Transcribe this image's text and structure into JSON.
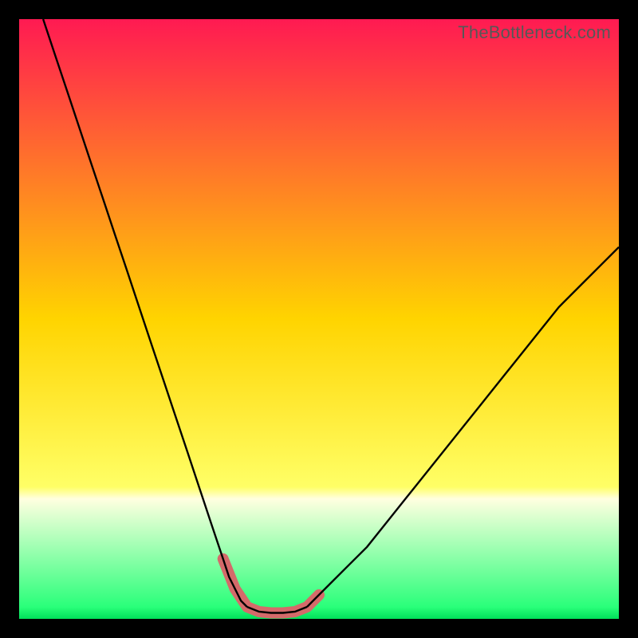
{
  "watermark": "TheBottleneck.com",
  "chart_data": {
    "type": "line",
    "title": "",
    "xlabel": "",
    "ylabel": "",
    "xlim": [
      0,
      100
    ],
    "ylim": [
      0,
      100
    ],
    "grid": false,
    "legend": false,
    "gradient_stops": [
      {
        "offset": 0.0,
        "color": "#ff1a52"
      },
      {
        "offset": 0.5,
        "color": "#ffd400"
      },
      {
        "offset": 0.78,
        "color": "#ffff66"
      },
      {
        "offset": 0.8,
        "color": "#ffffe0"
      },
      {
        "offset": 0.98,
        "color": "#2aff7a"
      },
      {
        "offset": 1.0,
        "color": "#00e05a"
      }
    ],
    "series": [
      {
        "name": "left-curve",
        "stroke": "#000000",
        "x": [
          4,
          6,
          8,
          10,
          12,
          14,
          16,
          18,
          20,
          22,
          24,
          26,
          28,
          30,
          32,
          34,
          35,
          36,
          37,
          38
        ],
        "y": [
          100,
          94,
          88,
          82,
          76,
          70,
          64,
          58,
          52,
          46,
          40,
          34,
          28,
          22,
          16,
          10,
          7,
          5,
          3,
          2
        ]
      },
      {
        "name": "right-curve",
        "stroke": "#000000",
        "x": [
          48,
          49,
          50,
          52,
          55,
          58,
          62,
          66,
          70,
          74,
          78,
          82,
          86,
          90,
          94,
          98,
          100
        ],
        "y": [
          2,
          3,
          4,
          6,
          9,
          12,
          17,
          22,
          27,
          32,
          37,
          42,
          47,
          52,
          56,
          60,
          62
        ]
      },
      {
        "name": "bottom-flat",
        "stroke": "#000000",
        "x": [
          38,
          40,
          42,
          44,
          46,
          48
        ],
        "y": [
          2,
          1.2,
          1,
          1,
          1.2,
          2
        ]
      },
      {
        "name": "marker-band",
        "type": "thick-line",
        "stroke": "#d46a6a",
        "stroke_width": 14,
        "x": [
          34,
          36,
          38,
          40,
          42,
          44,
          46,
          48,
          49,
          50
        ],
        "y": [
          10,
          5,
          2,
          1.2,
          1,
          1,
          1.2,
          2,
          3,
          4
        ]
      }
    ],
    "note": "Axis values are not shown on-screen; x/y ranges and data are estimated as 0–100 from curve geometry."
  }
}
